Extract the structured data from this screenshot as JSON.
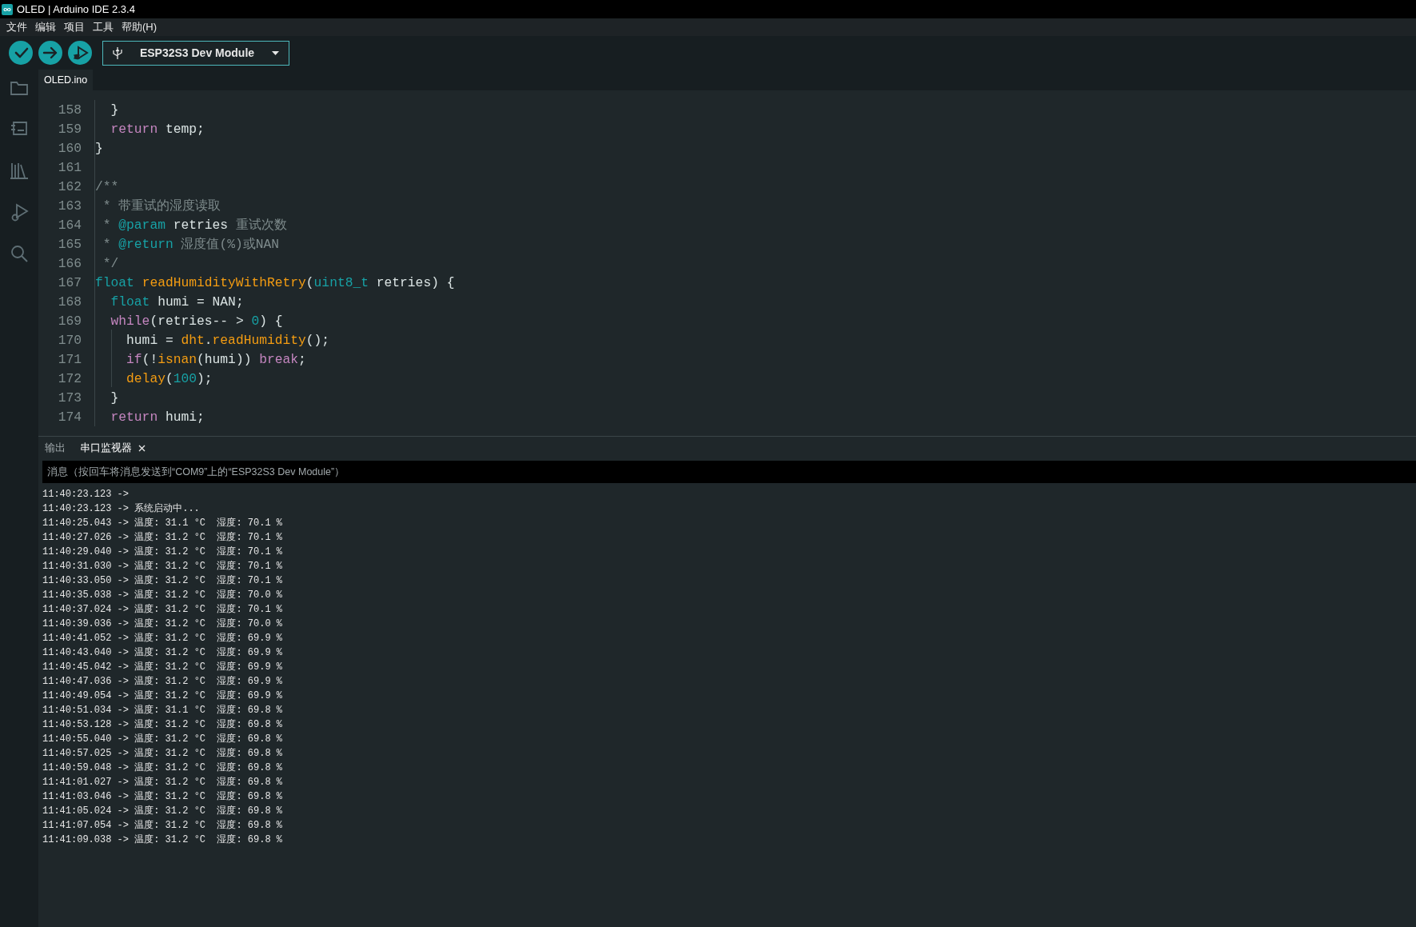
{
  "window": {
    "title": "OLED | Arduino IDE 2.3.4"
  },
  "menu": [
    "文件",
    "编辑",
    "项目",
    "工具",
    "帮助(H)"
  ],
  "toolbar_buttons": [
    {
      "kind": "verify"
    },
    {
      "kind": "upload"
    },
    {
      "kind": "debug"
    }
  ],
  "board_selector": {
    "label": "ESP32S3 Dev Module"
  },
  "sidebar": [
    {
      "kind": "folder"
    },
    {
      "kind": "board"
    },
    {
      "kind": "library"
    },
    {
      "kind": "debug"
    },
    {
      "kind": "search"
    }
  ],
  "editor_tabs": [
    {
      "label": "OLED.ino",
      "selected": true
    }
  ],
  "code_lines": [
    {
      "number": "158",
      "tokens": [
        {
          "kind": "plain",
          "text": "  }"
        }
      ]
    },
    {
      "number": "159",
      "tokens": [
        {
          "kind": "keyword",
          "text": "  return"
        },
        {
          "kind": "plain",
          "text": " temp;"
        }
      ]
    },
    {
      "number": "160",
      "tokens": [
        {
          "kind": "plain",
          "text": "}"
        }
      ]
    },
    {
      "number": "161"
    },
    {
      "number": "162",
      "tokens": [
        {
          "kind": "comment",
          "text": "/**"
        }
      ]
    },
    {
      "number": "163",
      "tokens": [
        {
          "kind": "comment",
          "text": " * 带重试的湿度读取"
        }
      ]
    },
    {
      "number": "164",
      "tokens": [
        {
          "kind": "comment",
          "text": " * "
        },
        {
          "kind": "tag",
          "text": "@param"
        },
        {
          "kind": "plain",
          "text": " retries"
        },
        {
          "kind": "comment",
          "text": " 重试次数"
        }
      ]
    },
    {
      "number": "165",
      "tokens": [
        {
          "kind": "comment",
          "text": " * "
        },
        {
          "kind": "tag",
          "text": "@return"
        },
        {
          "kind": "comment",
          "text": " 湿度值(%)或NAN"
        }
      ]
    },
    {
      "number": "166",
      "tokens": [
        {
          "kind": "comment",
          "text": " */"
        }
      ]
    },
    {
      "number": "167",
      "tokens": [
        {
          "kind": "type",
          "text": "float"
        },
        {
          "kind": "function",
          "text": " readHumidityWithRetry"
        },
        {
          "kind": "plain",
          "text": "("
        },
        {
          "kind": "type",
          "text": "uint8_t"
        },
        {
          "kind": "plain",
          "text": " retries) {"
        }
      ]
    },
    {
      "number": "168",
      "tokens": [
        {
          "kind": "type",
          "text": "  float"
        },
        {
          "kind": "plain",
          "text": " humi = NAN;"
        }
      ]
    },
    {
      "number": "169",
      "tokens": [
        {
          "kind": "keyword",
          "text": "  while"
        },
        {
          "kind": "plain",
          "text": "(retries-- > "
        },
        {
          "kind": "number",
          "text": "0"
        },
        {
          "kind": "plain",
          "text": ") {"
        }
      ]
    },
    {
      "number": "170",
      "tokens": [
        {
          "kind": "plain",
          "text": "    humi = "
        },
        {
          "kind": "function",
          "text": "dht"
        },
        {
          "kind": "plain",
          "text": "."
        },
        {
          "kind": "function",
          "text": "readHumidity"
        },
        {
          "kind": "plain",
          "text": "();"
        }
      ]
    },
    {
      "number": "171",
      "tokens": [
        {
          "kind": "keyword",
          "text": "    if"
        },
        {
          "kind": "plain",
          "text": "(!"
        },
        {
          "kind": "function",
          "text": "isnan"
        },
        {
          "kind": "plain",
          "text": "(humi)) "
        },
        {
          "kind": "keyword",
          "text": "break"
        },
        {
          "kind": "plain",
          "text": ";"
        }
      ]
    },
    {
      "number": "172",
      "tokens": [
        {
          "kind": "function",
          "text": "    delay"
        },
        {
          "kind": "plain",
          "text": "("
        },
        {
          "kind": "number",
          "text": "100"
        },
        {
          "kind": "plain",
          "text": ");"
        }
      ]
    },
    {
      "number": "173",
      "tokens": [
        {
          "kind": "plain",
          "text": "  }"
        }
      ]
    },
    {
      "number": "174",
      "tokens": [
        {
          "kind": "keyword",
          "text": "  return"
        },
        {
          "kind": "plain",
          "text": " humi;"
        }
      ]
    }
  ],
  "panel_tabs": [
    {
      "label": "输出",
      "selected": false,
      "closable": false
    },
    {
      "label": "串口监视器",
      "selected": true,
      "closable": true
    }
  ],
  "message_field": {
    "placeholder": "消息（按回车将消息发送到“COM9”上的“ESP32S3 Dev Module”）"
  },
  "serial_output": [
    "11:40:23.123 ->",
    "11:40:23.123 -> 系统启动中...",
    "11:40:25.043 -> 温度: 31.1 °C  湿度: 70.1 %",
    "11:40:27.026 -> 温度: 31.2 °C  湿度: 70.1 %",
    "11:40:29.040 -> 温度: 31.2 °C  湿度: 70.1 %",
    "11:40:31.030 -> 温度: 31.2 °C  湿度: 70.1 %",
    "11:40:33.050 -> 温度: 31.2 °C  湿度: 70.1 %",
    "11:40:35.038 -> 温度: 31.2 °C  湿度: 70.0 %",
    "11:40:37.024 -> 温度: 31.2 °C  湿度: 70.1 %",
    "11:40:39.036 -> 温度: 31.2 °C  湿度: 70.0 %",
    "11:40:41.052 -> 温度: 31.2 °C  湿度: 69.9 %",
    "11:40:43.040 -> 温度: 31.2 °C  湿度: 69.9 %",
    "11:40:45.042 -> 温度: 31.2 °C  湿度: 69.9 %",
    "11:40:47.036 -> 温度: 31.2 °C  湿度: 69.9 %",
    "11:40:49.054 -> 温度: 31.2 °C  湿度: 69.9 %",
    "11:40:51.034 -> 温度: 31.1 °C  湿度: 69.8 %",
    "11:40:53.128 -> 温度: 31.2 °C  湿度: 69.8 %",
    "11:40:55.040 -> 温度: 31.2 °C  湿度: 69.8 %",
    "11:40:57.025 -> 温度: 31.2 °C  湿度: 69.8 %",
    "11:40:59.048 -> 温度: 31.2 °C  湿度: 69.8 %",
    "11:41:01.027 -> 温度: 31.2 °C  湿度: 69.8 %",
    "11:41:03.046 -> 温度: 31.2 °C  湿度: 69.8 %",
    "11:41:05.024 -> 温度: 31.2 °C  湿度: 69.8 %",
    "11:41:07.054 -> 温度: 31.2 °C  湿度: 69.8 %",
    "11:41:09.038 -> 温度: 31.2 °C  湿度: 69.8 %"
  ]
}
